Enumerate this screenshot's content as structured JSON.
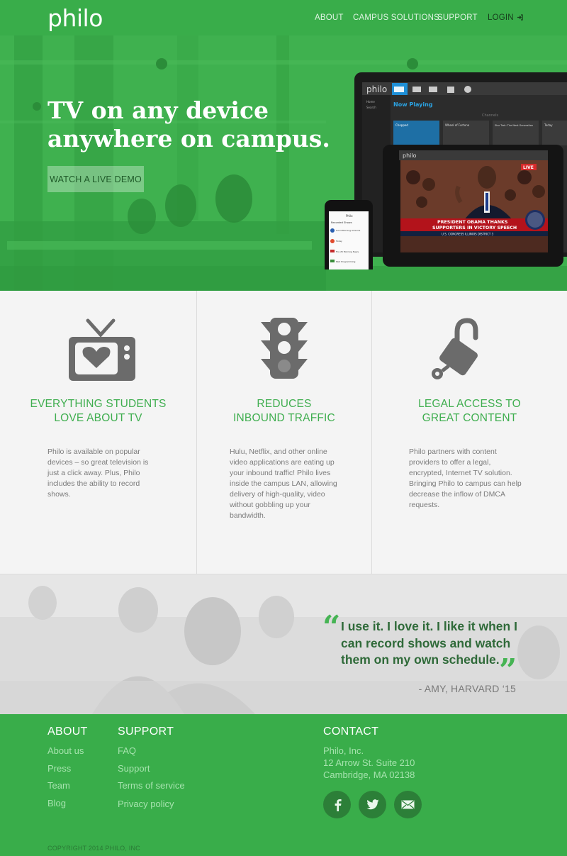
{
  "header": {
    "logo": "philo",
    "nav": [
      "ABOUT",
      "CAMPUS SOLUTIONS",
      "SUPPORT",
      "LOGIN"
    ]
  },
  "hero": {
    "headline": "TV on any device anywhere on campus.",
    "cta": "WATCH A LIVE DEMO",
    "device": {
      "app_logo": "philo",
      "section": "Now Playing",
      "menu": [
        "Home",
        "Search"
      ],
      "channels": "Channels",
      "cards": [
        "Chopped",
        "Wheel of Fortune",
        "Star Trek: The Next Generation",
        "Today"
      ],
      "live_badge": "LIVE",
      "ticker_line1": "PRESIDENT OBAMA THANKS",
      "ticker_line2": "SUPPORTERS IN VICTORY SPEECH",
      "ticker_sub": "U.S. CONGRESS ILLINOIS DISTRICT 3",
      "phone_title": "Philo",
      "phone_section": "Recorded Shows",
      "phone_items": [
        "Good Morning America",
        "Today",
        "Fox 25 Morning News",
        "Paid Programming"
      ]
    }
  },
  "features": [
    {
      "icon": "tv-heart-icon",
      "title": "EVERYTHING STUDENTS LOVE ABOUT TV",
      "text": "Philo is available on popular devices – so great television is just a click away. Plus, Philo includes the ability to record shows."
    },
    {
      "icon": "traffic-light-icon",
      "title": "REDUCES INBOUND TRAFFIC",
      "text": "Hulu, Netflix, and other online video applications are eating up your inbound traffic! Philo lives inside the campus LAN, allowing delivery of high-quality, video without gobbling up your bandwidth."
    },
    {
      "icon": "unlocked-padlock-icon",
      "title": "LEGAL ACCESS TO GREAT CONTENT",
      "text": "Philo partners with content providers to offer a legal, encrypted, Internet TV solution. Bringing Philo to campus can help decrease the inflow of DMCA requests."
    }
  ],
  "quote": {
    "text": "I use it. I love it. I like it when I can record shows and watch them on my own schedule.",
    "author": "- AMY, HARVARD ‘15"
  },
  "footer": {
    "about": {
      "heading": "ABOUT",
      "links": [
        "About us",
        "Press",
        "Team",
        "Blog"
      ]
    },
    "support": {
      "heading": "SUPPORT",
      "links": [
        "FAQ",
        "Support",
        "Terms of service",
        "Privacy policy"
      ]
    },
    "contact": {
      "heading": "CONTACT",
      "lines": [
        "Philo, Inc.",
        "12 Arrow St. Suite 210",
        "Cambridge, MA 02138"
      ],
      "social": [
        "facebook-icon",
        "twitter-icon",
        "email-icon"
      ]
    },
    "copyright": "COPYRIGHT 2014 PHILO, INC"
  },
  "colors": {
    "brand_green": "#39ad4a",
    "title_green": "#3fae4f",
    "quote_green": "#2f6a39",
    "feature_bg": "#f4f4f4",
    "icon_gray": "#6b6b6b"
  }
}
